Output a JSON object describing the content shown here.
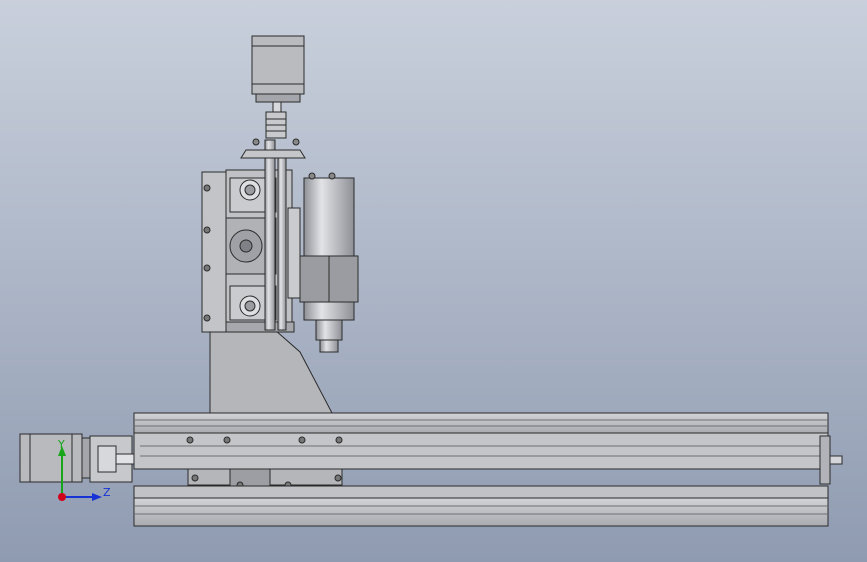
{
  "viewport": {
    "background_top": "#c9d0dc",
    "background_bottom": "#8f9bb1"
  },
  "colors": {
    "metal": "#b7b9bd",
    "metal_light": "#d9dadd",
    "metal_dark": "#8d9096",
    "line": "#2b2b2b",
    "axis_x": "#d0021b",
    "axis_y": "#17a51a",
    "axis_z": "#1733d6"
  },
  "triad": {
    "y_label": "Y",
    "z_label": "Z",
    "x_icon": "x-axis-dot-icon"
  },
  "parts": {
    "top_motor": "z-stepper-motor",
    "coupler": "shaft-coupler",
    "gantry_plate": "gantry-side-plate",
    "y_motor": "y-stepper-motor",
    "spindle": "spindle-motor",
    "base_rail": "aluminum-extrusion-rail"
  }
}
